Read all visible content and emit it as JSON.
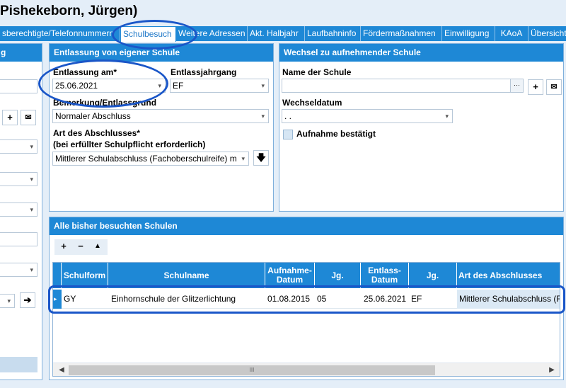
{
  "window": {
    "title": "Pishekeborn, Jürgen)"
  },
  "tabs": [
    "sberechtigte/Telefonnummern",
    "Schulbesuch",
    "Weitere Adressen",
    "Akt. Halbjahr",
    "Laufbahninfo",
    "Fördermaßnahmen",
    "Einwilligung",
    "KAoA",
    "Übersicht"
  ],
  "entlassung": {
    "header": "Entlassung von eigener Schule",
    "date_label": "Entlassung am*",
    "date_value": "25.06.2021",
    "jahrgang_label": "Entlassjahrgang",
    "jahrgang_value": "EF",
    "grund_label": "Bemerkung/Entlassgrund",
    "grund_value": "Normaler Abschluss",
    "abschluss_label": "Art des Abschlusses*",
    "abschluss_note": "(bei erfüllter Schulpflicht erforderlich)",
    "abschluss_value": "Mittlerer Schulabschluss (Fachoberschulreife) m"
  },
  "wechsel": {
    "header": "Wechsel zu aufnehmender Schule",
    "schule_label": "Name der Schule",
    "schule_value": "",
    "ellipsis": "···",
    "datum_label": "Wechseldatum",
    "datum_value": " .  .",
    "bestaetigt_label": "Aufnahme bestätigt"
  },
  "schulen": {
    "header": "Alle bisher besuchten Schulen",
    "columns": [
      "Schulform",
      "Schulname",
      "Aufnahme-Datum",
      "Jg.",
      "Entlass-Datum",
      "Jg.",
      "Art des Abschlusses"
    ],
    "rows": [
      [
        "GY",
        "Einhornschule der Glitzerlichtung",
        "01.08.2015",
        "05",
        "25.06.2021",
        "EF",
        "Mittlerer Schulabschluss (F"
      ]
    ],
    "scroll_grip": "III"
  },
  "left_panel": {
    "header": "g"
  },
  "glyphs": {
    "plus": "+",
    "minus": "−",
    "up": "▲",
    "dropdown": "▾",
    "arrow_right": "➔",
    "arrow_down": "🡇",
    "scroll_left": "◀",
    "scroll_right": "▶",
    "row_pointer": "▸"
  },
  "colors": {
    "accent": "#1e88d6",
    "highlight": "#1a56c8",
    "background": "#e4eef8"
  }
}
